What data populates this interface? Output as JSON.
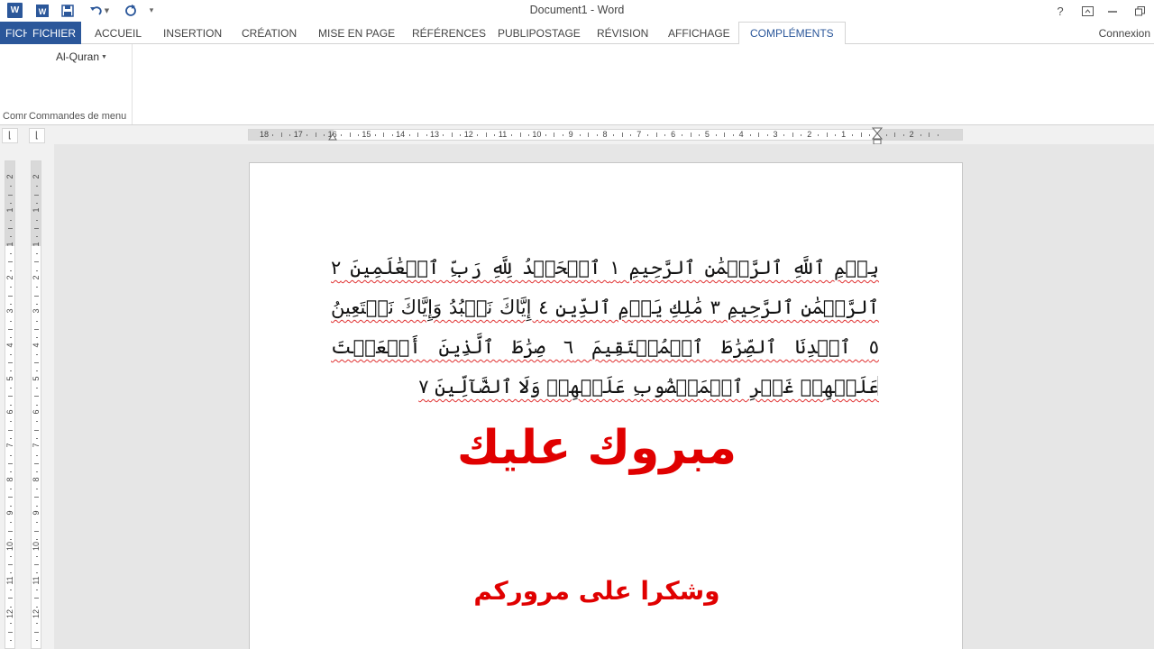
{
  "window": {
    "title": "Document1 - Word",
    "app_icon": "word-icon",
    "help_label": "?",
    "quick_access": [
      "word-icon",
      "save-icon",
      "undo-icon",
      "redo-icon",
      "customize-qat-icon"
    ],
    "controls": [
      "ribbon-display-icon",
      "minimize-icon",
      "restore-icon"
    ]
  },
  "tabs": {
    "file_overlay": "FICH",
    "items": [
      {
        "label": "FICHIER"
      },
      {
        "label": "ACCUEIL"
      },
      {
        "label": "INSERTION"
      },
      {
        "label": "CRÉATION"
      },
      {
        "label": "MISE EN PAGE"
      },
      {
        "label": "RÉFÉRENCES"
      },
      {
        "label": "PUBLIPOSTAGE"
      },
      {
        "label": "RÉVISION"
      },
      {
        "label": "AFFICHAGE"
      },
      {
        "label": "COMPLÉMENTS"
      }
    ],
    "active": "COMPLÉMENTS",
    "signin": "Connexion"
  },
  "ribbon": {
    "addin_button": "Al-Quran",
    "group_label_clipped": "Comm",
    "group_label": "Commandes de menu"
  },
  "ruler": {
    "horizontal_ticks": [
      "18",
      "17",
      "16",
      "15",
      "14",
      "13",
      "12",
      "11",
      "10",
      "9",
      "8",
      "7",
      "6",
      "5",
      "4",
      "3",
      "2",
      "1",
      "1",
      "2"
    ],
    "vertical_left_ticks": [
      "2",
      "1",
      "1",
      "2",
      "3",
      "4",
      "5",
      "6",
      "7",
      "8",
      "9",
      "10",
      "11",
      "12"
    ],
    "vertical_right_ticks": [
      "2",
      "1",
      "1",
      "2",
      "3",
      "4",
      "5",
      "6",
      "7",
      "8",
      "9",
      "10",
      "11",
      "12"
    ]
  },
  "document": {
    "quran_text": "بِسۡمِ ٱللَّهِ ٱلرَّحۡمَٰنِ ٱلرَّحِيمِ ١ ٱلۡحَمۡدُ لِلَّهِ رَبِّ ٱلۡعَٰلَمِينَ ٢ ٱلرَّحۡمَٰنِ ٱلرَّحِيمِ ٣ مَٰلِكِ يَوۡمِ ٱلدِّينِ ٤ إِيَّاكَ نَعۡبُدُ وَإِيَّاكَ نَسۡتَعِينُ ٥ ٱهۡدِنَا ٱلصِّرَٰطَ ٱلۡمُسۡتَقِيمَ ٦ صِرَٰطَ ٱلَّذِينَ أَنۡعَمۡتَ عَلَيۡهِمۡ غَيۡرِ ٱلۡمَغۡضُوبِ عَلَيۡهِمۡ وَلَا ٱلضَّآلِّينَ ٧",
    "congrats": "مبروك عليك",
    "thanks": "وشكرا على مروركم"
  },
  "colors": {
    "word_blue": "#2b579a",
    "red_text": "#e00000",
    "spell_underline": "#e03030"
  }
}
